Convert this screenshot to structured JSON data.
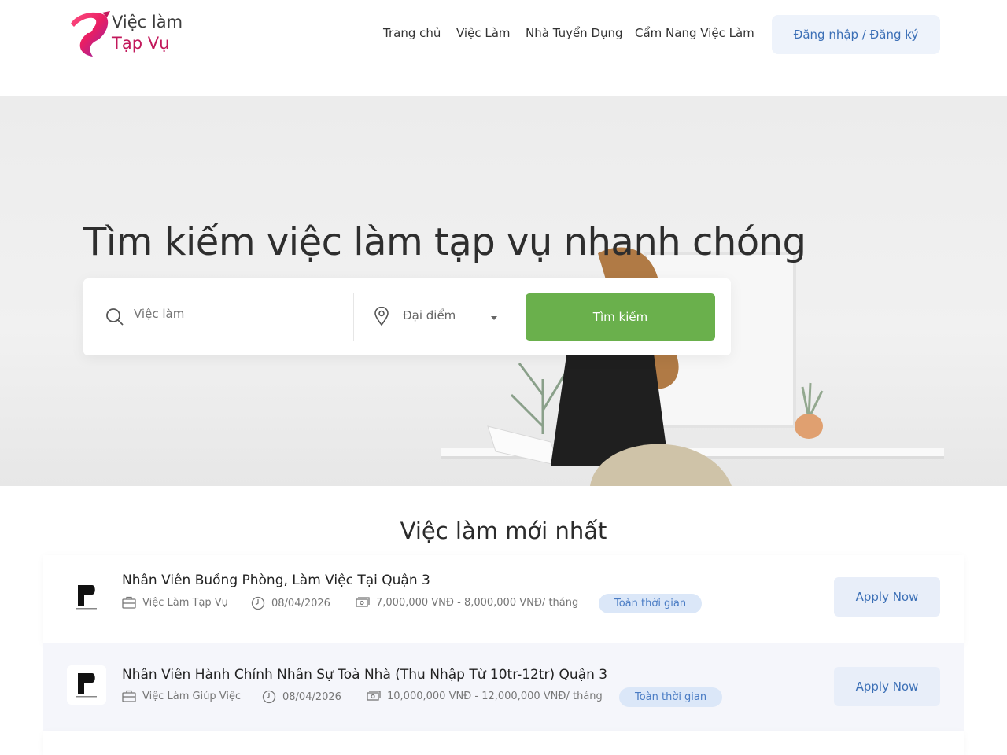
{
  "brand": {
    "line1": "Việc làm",
    "line2": "Tạp Vụ",
    "colors": {
      "pink": "#e91e63",
      "magenta": "#c2185b",
      "purple": "#8e24aa"
    }
  },
  "nav": {
    "items": [
      {
        "label": "Trang chủ"
      },
      {
        "label": "Việc Làm"
      },
      {
        "label": "Nhà Tuyển Dụng"
      },
      {
        "label": "Cẩm Nang Việc Làm"
      }
    ],
    "login_label": "Đăng nhập / Đăng ký"
  },
  "hero": {
    "title": "Tìm kiếm việc làm tạp vụ nhanh chóng",
    "search_placeholder": "Việc làm",
    "location_label": "Đại điểm",
    "search_button": "Tìm kiếm",
    "accent_color": "#6ab04c"
  },
  "latest": {
    "title": "Việc làm mới nhất",
    "jobs": [
      {
        "title": "Nhân Viên Buồng Phòng, Làm Việc Tại Quận 3",
        "category": "Việc Làm Tạp Vụ",
        "date": "08/04/2026",
        "salary": "7,000,000 VNĐ - 8,000,000 VNĐ/ tháng",
        "type": "Toàn thời gian",
        "apply": "Apply Now"
      },
      {
        "title": "Nhân Viên Hành Chính Nhân Sự Toà Nhà (Thu Nhập Từ 10tr-12tr) Quận 3",
        "category": "Việc Làm Giúp Việc",
        "date": "08/04/2026",
        "salary": "10,000,000 VNĐ - 12,000,000 VNĐ/ tháng",
        "type": "Toàn thời gian",
        "apply": "Apply Now"
      }
    ]
  }
}
